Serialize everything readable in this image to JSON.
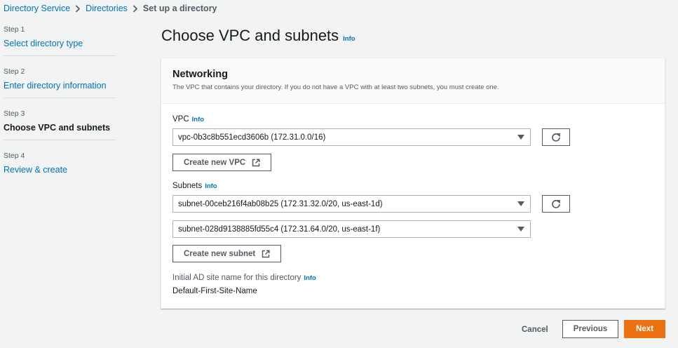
{
  "breadcrumb": {
    "items": [
      {
        "label": "Directory Service"
      },
      {
        "label": "Directories"
      }
    ],
    "current": "Set up a directory"
  },
  "steps": [
    {
      "step_label": "Step 1",
      "title": "Select directory type"
    },
    {
      "step_label": "Step 2",
      "title": "Enter directory information"
    },
    {
      "step_label": "Step 3",
      "title": "Choose VPC and subnets"
    },
    {
      "step_label": "Step 4",
      "title": "Review & create"
    }
  ],
  "page": {
    "title": "Choose VPC and subnets",
    "info": "Info"
  },
  "networking": {
    "title": "Networking",
    "description": "The VPC that contains your directory. If you do not have a VPC with at least two subnets, you must create one.",
    "vpc_label": "VPC",
    "vpc_info": "Info",
    "vpc_value": "vpc-0b3c8b551ecd3606b (172.31.0.0/16)",
    "create_vpc_label": "Create new VPC",
    "subnets_label": "Subnets",
    "subnets_info": "Info",
    "subnet_1_value": "subnet-00ceb216f4ab08b25 (172.31.32.0/20, us-east-1d)",
    "subnet_2_value": "subnet-028d9138885fd55c4 (172.31.64.0/20, us-east-1f)",
    "create_subnet_label": "Create new subnet",
    "site_name_label": "Initial AD site name for this directory",
    "site_name_info": "Info",
    "site_name_value": "Default-First-Site-Name"
  },
  "actions": {
    "cancel": "Cancel",
    "previous": "Previous",
    "next": "Next"
  },
  "colors": {
    "link": "#0073bb",
    "primary_button": "#ec7211",
    "background": "#f2f3f3"
  },
  "icons": {
    "breadcrumb_separator": "chevron-right-icon",
    "select": "caret-down-icon",
    "refresh": "refresh-icon",
    "external": "external-link-icon"
  }
}
